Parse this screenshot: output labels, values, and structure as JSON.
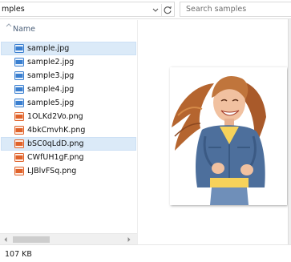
{
  "address_bar": {
    "path_text": "mples",
    "dropdown_icon": "chevron-down-icon",
    "refresh_icon": "refresh-icon"
  },
  "search": {
    "placeholder": "Search samples",
    "icon": "search-icon"
  },
  "file_list": {
    "column_header": "Name",
    "selected_file": "bSC0qLdD.png",
    "files": [
      {
        "name": "sample.jpg",
        "type": "jpg",
        "highlighted": true
      },
      {
        "name": "sample2.jpg",
        "type": "jpg"
      },
      {
        "name": "sample3.jpg",
        "type": "jpg"
      },
      {
        "name": "sample4.jpg",
        "type": "jpg"
      },
      {
        "name": "sample5.jpg",
        "type": "jpg"
      },
      {
        "name": "1OLKd2Vo.png",
        "type": "png"
      },
      {
        "name": "4bkCmvhK.png",
        "type": "png"
      },
      {
        "name": "bSC0qLdD.png",
        "type": "png",
        "selected": true
      },
      {
        "name": "CWfUH1gF.png",
        "type": "png"
      },
      {
        "name": "LJBlvFSq.png",
        "type": "png"
      }
    ]
  },
  "status_bar": {
    "file_size": "107 KB"
  },
  "colors": {
    "selection_bg": "#dbeaf8",
    "jpg_icon": "#3a7fd0",
    "png_icon": "#e0622a",
    "header_text": "#4c607a"
  }
}
